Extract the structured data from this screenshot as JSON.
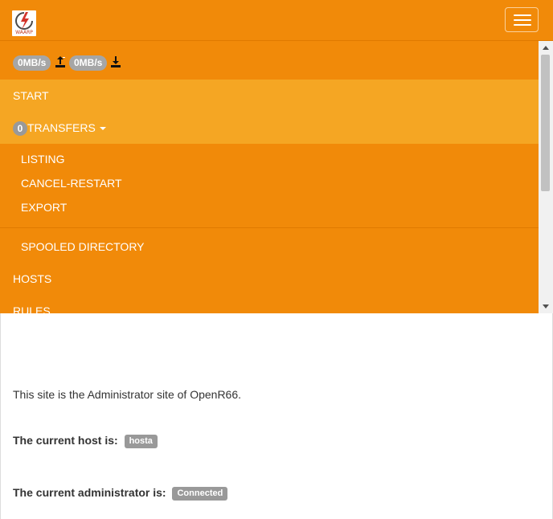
{
  "brand": {
    "logo_text": "WAARP",
    "logo_icon": "waarp-logo"
  },
  "header": {
    "menu_toggle_icon": "hamburger-icon"
  },
  "speeds": {
    "upload": "0MB/s",
    "download": "0MB/s",
    "upload_icon": "upload-icon",
    "download_icon": "download-icon"
  },
  "nav": {
    "start": "START",
    "transfers_count": "0",
    "transfers": "TRANSFERS",
    "transfers_menu": [
      "LISTING",
      "CANCEL-RESTART",
      "EXPORT"
    ],
    "spooled": "SPOOLED DIRECTORY",
    "hosts": "HOSTS",
    "rules": "RULES"
  },
  "main": {
    "intro": "This site is the Administrator site of OpenR66.",
    "host_label": "The current host is:",
    "host_value": "hosta",
    "admin_label": "The current administrator is:",
    "admin_value": "Connected"
  },
  "colors": {
    "nav_bg": "#f18a09",
    "nav_active_bg": "#f5a623",
    "badge_grey": "#999999"
  }
}
